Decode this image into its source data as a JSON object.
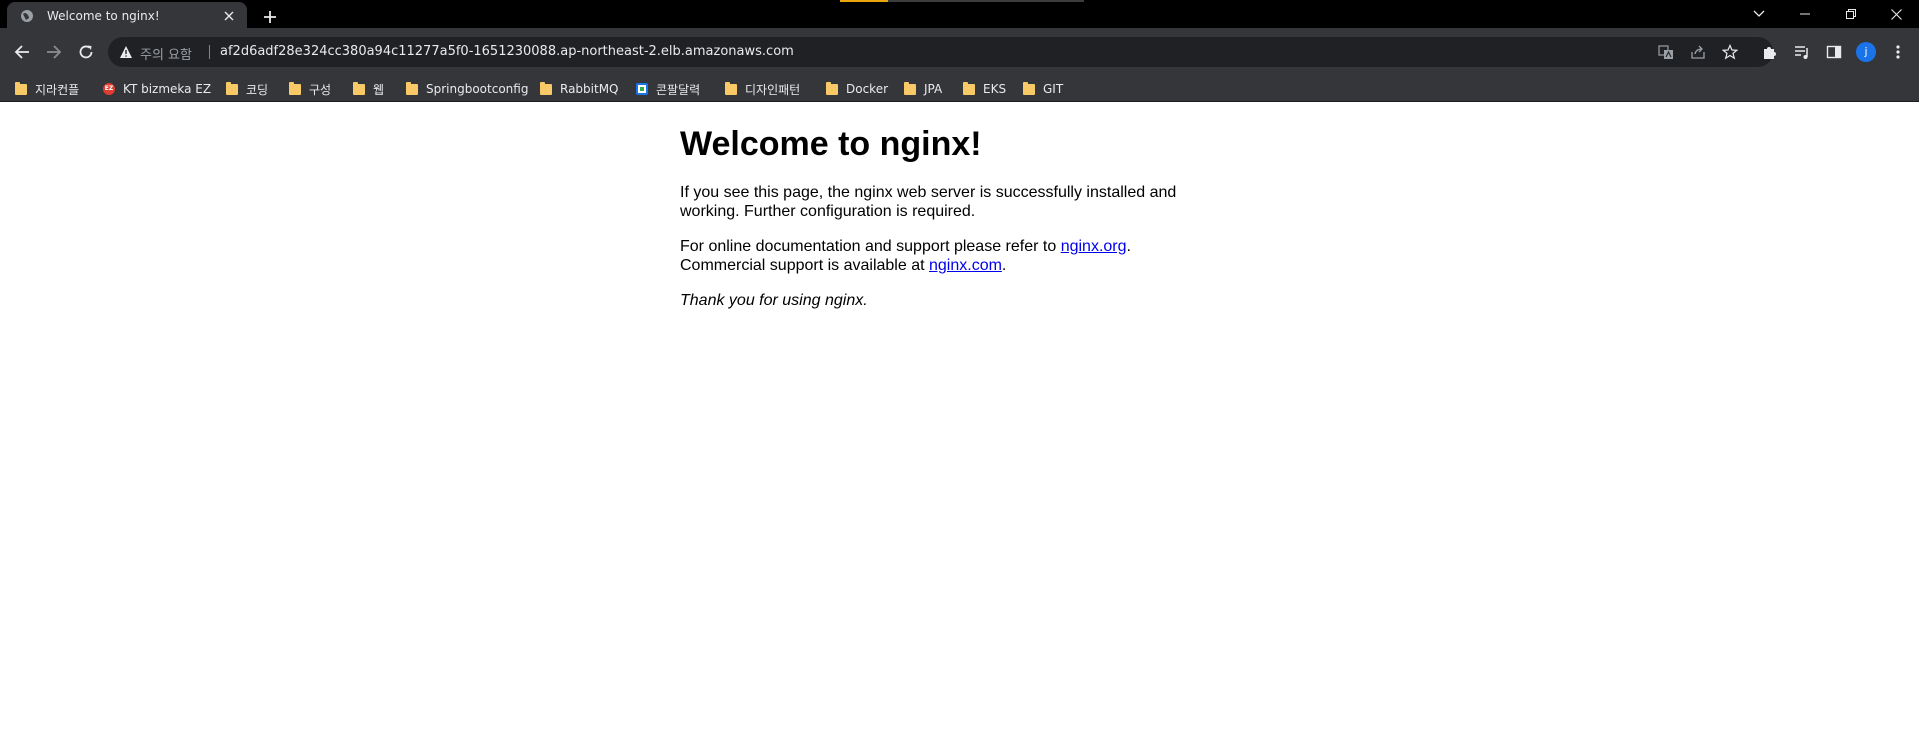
{
  "tab": {
    "title": "Welcome to nginx!",
    "favicon": "globe-icon"
  },
  "colors": {
    "tabstrip": "#000000",
    "toolbar": "#35363a",
    "omnibox": "#202124",
    "tab_indicator": "#e8a50d",
    "link": "#0000ee",
    "avatar": "#1a73e8",
    "folder": "#f8c966"
  },
  "omnibox": {
    "security_label": "주의 요함",
    "url": "af2d6adf28e324cc380a94c11277a5f0-1651230088.ap-northeast-2.elb.amazonaws.com"
  },
  "profile": {
    "initial": "j"
  },
  "bookmarks": [
    {
      "label": "지라컨플",
      "icon": "folder-icon"
    },
    {
      "label": "KT bizmeka EZ",
      "icon": "ez-icon"
    },
    {
      "label": "코딩",
      "icon": "folder-icon"
    },
    {
      "label": "구성",
      "icon": "folder-icon"
    },
    {
      "label": "웹",
      "icon": "folder-icon"
    },
    {
      "label": "Springbootconfig",
      "icon": "folder-icon"
    },
    {
      "label": "RabbitMQ",
      "icon": "folder-icon"
    },
    {
      "label": "콘팔달력",
      "icon": "calendar-icon"
    },
    {
      "label": "디자인패턴",
      "icon": "folder-icon"
    },
    {
      "label": "Docker",
      "icon": "folder-icon"
    },
    {
      "label": "JPA",
      "icon": "folder-icon"
    },
    {
      "label": "EKS",
      "icon": "folder-icon"
    },
    {
      "label": "GIT",
      "icon": "folder-icon"
    }
  ],
  "page": {
    "heading": "Welcome to nginx!",
    "para1": "If you see this page, the nginx web server is successfully installed and working. Further configuration is required.",
    "para2_prefix": "For online documentation and support please refer to ",
    "link1": "nginx.org",
    "para2_mid": ".",
    "para2_line2": "Commercial support is available at ",
    "link2": "nginx.com",
    "para2_end": ".",
    "thanks": "Thank you for using nginx."
  }
}
